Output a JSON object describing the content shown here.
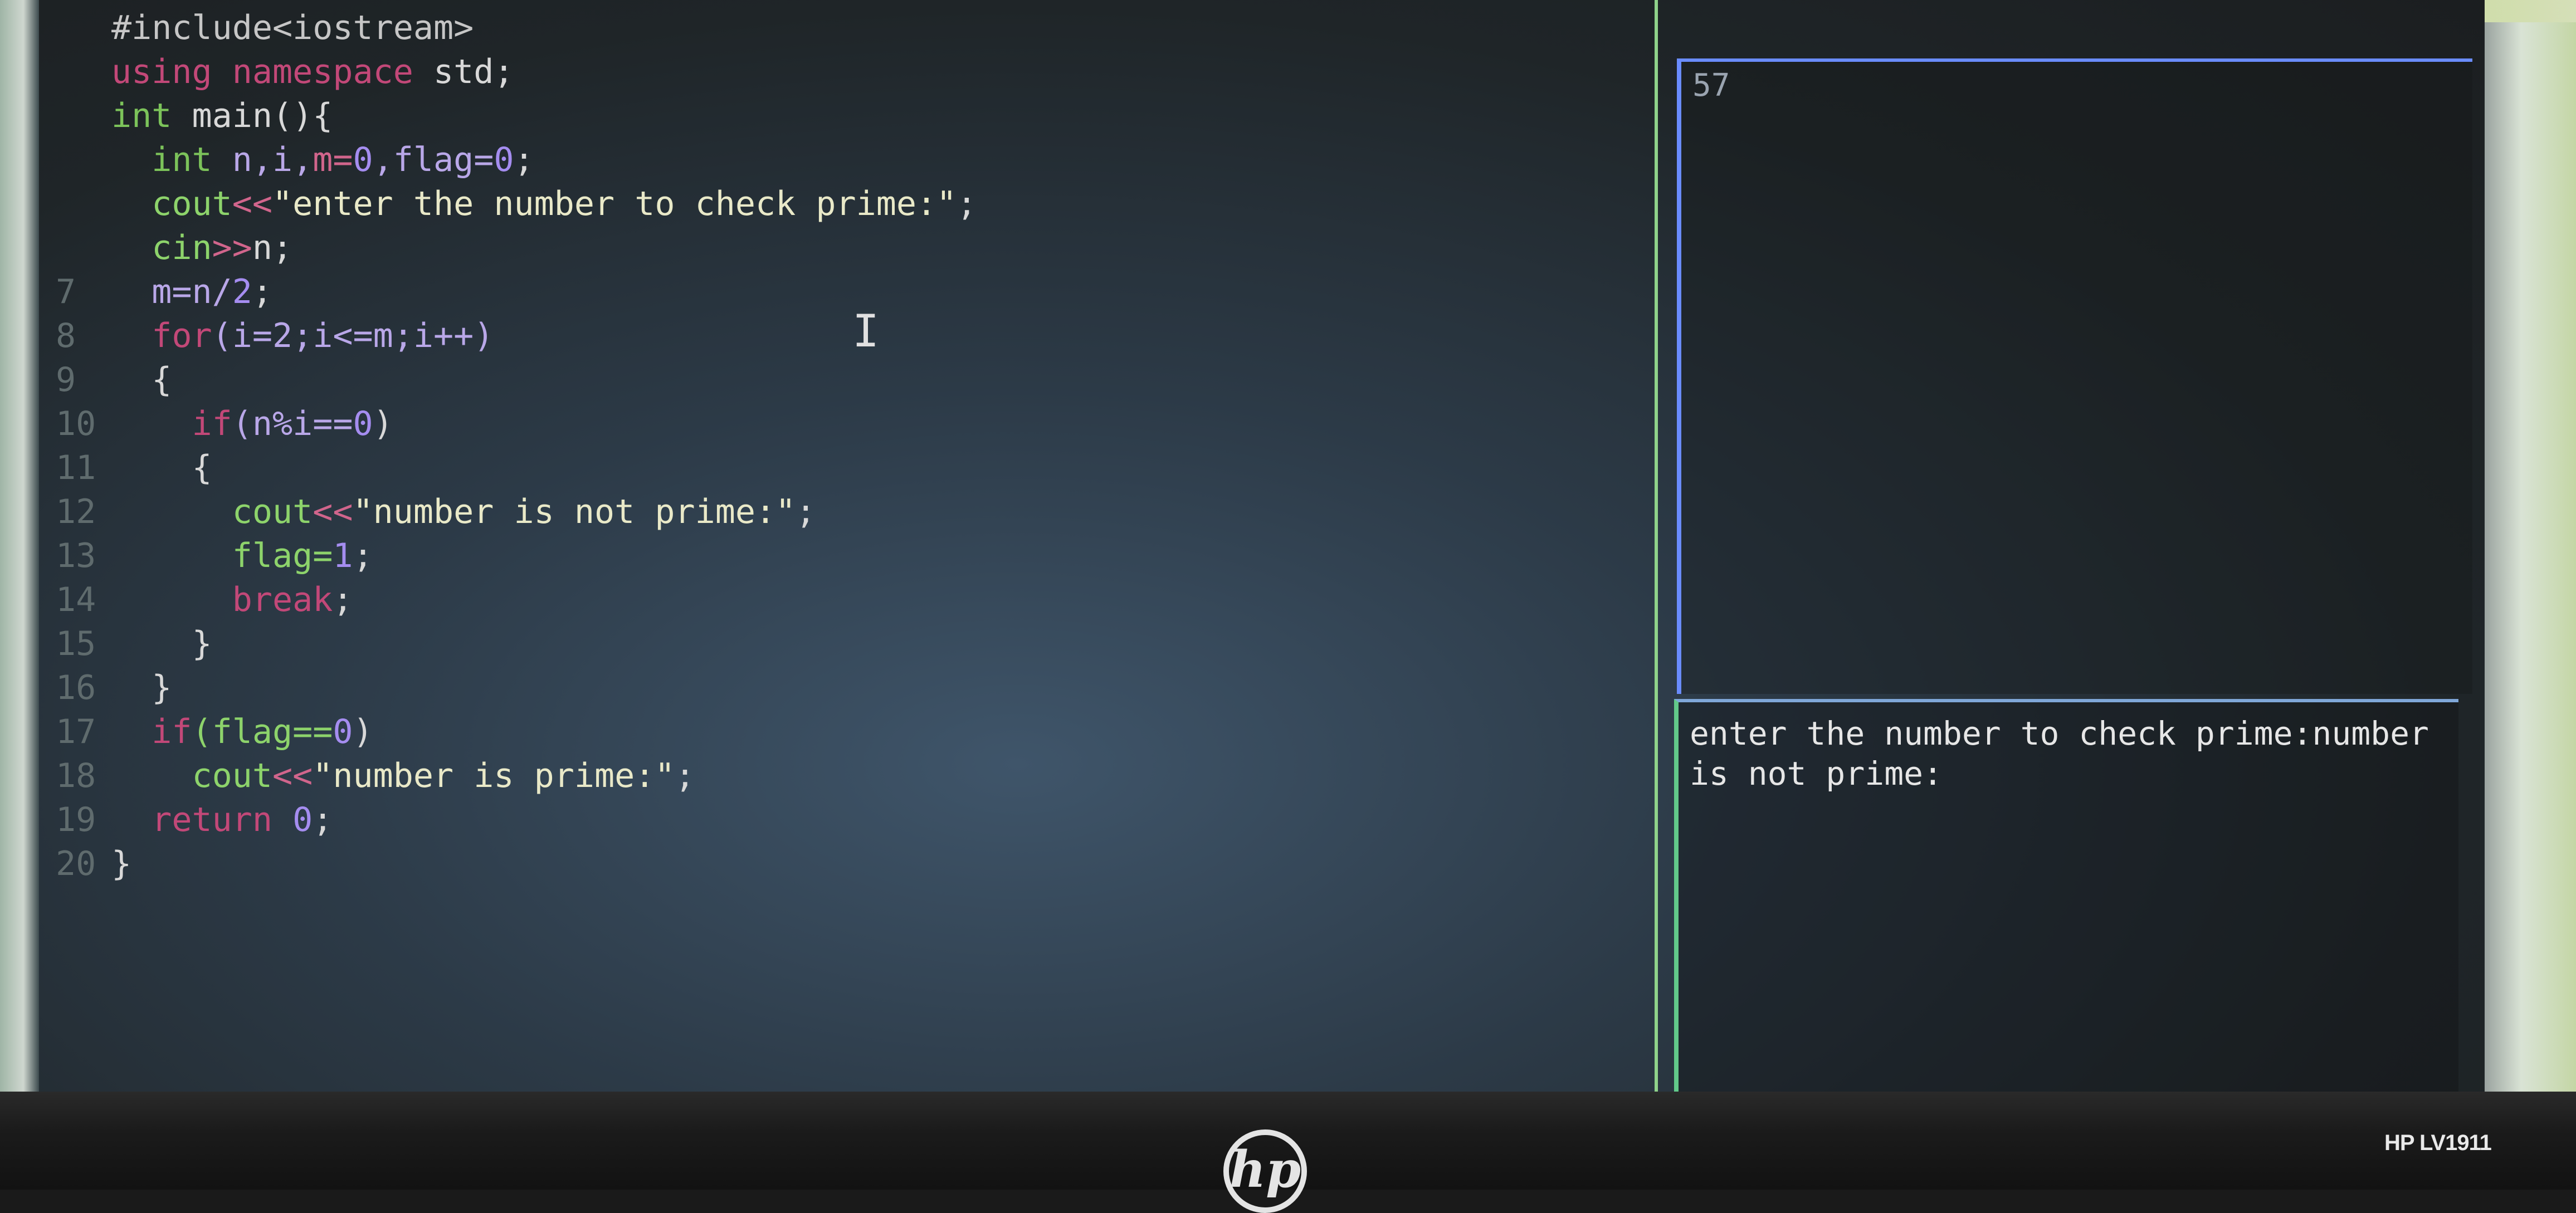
{
  "editor": {
    "lines": [
      {
        "num": "",
        "tokens": [
          {
            "t": "#include<iostream>",
            "c": "inc"
          }
        ]
      },
      {
        "num": "",
        "tokens": [
          {
            "t": "using namespace ",
            "c": "kw"
          },
          {
            "t": "std;",
            "c": "plain"
          }
        ]
      },
      {
        "num": "",
        "tokens": [
          {
            "t": "int ",
            "c": "type"
          },
          {
            "t": "main(){",
            "c": "plain"
          }
        ]
      },
      {
        "num": "",
        "tokens": [
          {
            "t": "  int ",
            "c": "type"
          },
          {
            "t": "n,i,",
            "c": "id"
          },
          {
            "t": "m=",
            "c": "op"
          },
          {
            "t": "0",
            "c": "num"
          },
          {
            "t": ",flag=",
            "c": "id"
          },
          {
            "t": "0",
            "c": "num"
          },
          {
            "t": ";",
            "c": "plain"
          }
        ]
      },
      {
        "num": "",
        "tokens": [
          {
            "t": "  cout",
            "c": "fn"
          },
          {
            "t": "<<",
            "c": "op"
          },
          {
            "t": "\"enter the number to check prime:\"",
            "c": "str"
          },
          {
            "t": ";",
            "c": "plain"
          }
        ]
      },
      {
        "num": "",
        "tokens": [
          {
            "t": "  cin",
            "c": "fn"
          },
          {
            "t": ">>",
            "c": "op"
          },
          {
            "t": "n;",
            "c": "plain"
          }
        ]
      },
      {
        "num": "7",
        "tokens": [
          {
            "t": "  m=n/",
            "c": "id"
          },
          {
            "t": "2",
            "c": "num"
          },
          {
            "t": ";",
            "c": "plain"
          }
        ]
      },
      {
        "num": "8",
        "tokens": [
          {
            "t": "  for",
            "c": "kw"
          },
          {
            "t": "(i=2;i<=m;i++)",
            "c": "id"
          }
        ]
      },
      {
        "num": "9",
        "tokens": [
          {
            "t": "  {",
            "c": "plain"
          }
        ]
      },
      {
        "num": "10",
        "tokens": [
          {
            "t": "    if",
            "c": "kw"
          },
          {
            "t": "(n%i==",
            "c": "id"
          },
          {
            "t": "0",
            "c": "num"
          },
          {
            "t": ")",
            "c": "plain"
          }
        ]
      },
      {
        "num": "11",
        "tokens": [
          {
            "t": "    {",
            "c": "plain"
          }
        ]
      },
      {
        "num": "12",
        "tokens": [
          {
            "t": "      cout",
            "c": "fn"
          },
          {
            "t": "<<",
            "c": "op"
          },
          {
            "t": "\"number is not prime:\"",
            "c": "str"
          },
          {
            "t": ";",
            "c": "plain"
          }
        ]
      },
      {
        "num": "13",
        "tokens": [
          {
            "t": "      flag=",
            "c": "fn"
          },
          {
            "t": "1",
            "c": "num"
          },
          {
            "t": ";",
            "c": "plain"
          }
        ]
      },
      {
        "num": "14",
        "tokens": [
          {
            "t": "      break",
            "c": "kw"
          },
          {
            "t": ";",
            "c": "plain"
          }
        ]
      },
      {
        "num": "15",
        "tokens": [
          {
            "t": "    }",
            "c": "plain"
          }
        ]
      },
      {
        "num": "16",
        "tokens": [
          {
            "t": "  }",
            "c": "plain"
          }
        ]
      },
      {
        "num": "17",
        "tokens": [
          {
            "t": "  if",
            "c": "kw"
          },
          {
            "t": "(flag==",
            "c": "fn"
          },
          {
            "t": "0",
            "c": "num"
          },
          {
            "t": ")",
            "c": "plain"
          }
        ]
      },
      {
        "num": "18",
        "tokens": [
          {
            "t": "    cout",
            "c": "fn"
          },
          {
            "t": "<<",
            "c": "op"
          },
          {
            "t": "\"number is prime:\"",
            "c": "str"
          },
          {
            "t": ";",
            "c": "plain"
          }
        ]
      },
      {
        "num": "19",
        "tokens": [
          {
            "t": "  return ",
            "c": "kw"
          },
          {
            "t": "0",
            "c": "num"
          },
          {
            "t": ";",
            "c": "plain"
          }
        ]
      },
      {
        "num": "20",
        "tokens": [
          {
            "t": "}",
            "c": "plain"
          }
        ]
      }
    ]
  },
  "preview_pane": {
    "number": "57"
  },
  "output_pane": {
    "text": "enter the number to check prime:number is not prime:"
  },
  "monitor": {
    "brand_logo": "hp",
    "model": "HP LV1911"
  },
  "colors": {
    "keyword": "#c24878",
    "type": "#7cc35a",
    "function": "#8dd36b",
    "number": "#a58df0",
    "string": "#e9e9c8",
    "operator": "#d1658c"
  }
}
